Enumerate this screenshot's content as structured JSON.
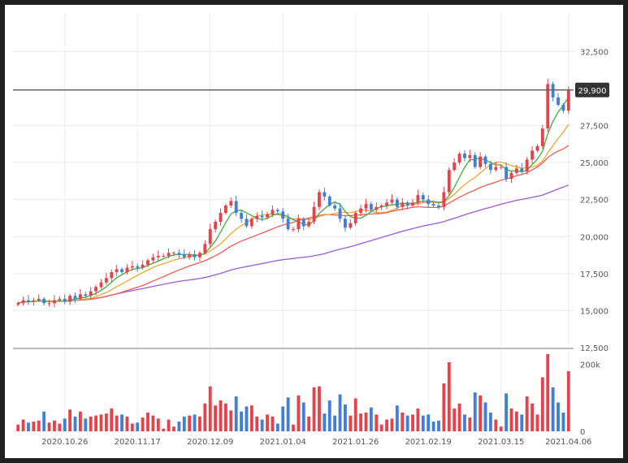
{
  "chart_data": {
    "type": "candlestick",
    "colors": {
      "up": "#e8414a",
      "down": "#3f7fd8",
      "ma_green": "#3caf3c",
      "ma_orange": "#f2a531",
      "ma_red": "#f15a5a",
      "ma_purple": "#9b5ad8",
      "grid": "#ececec",
      "current_price_line": "#666666",
      "current_price_label_bg": "#333333"
    },
    "y_ticks": [
      "32,500",
      "30,000",
      "27,500",
      "25,000",
      "22,500",
      "20,000",
      "17,500",
      "15,000",
      "12,500"
    ],
    "volume_ticks": [
      "200k",
      "0"
    ],
    "x_labels": [
      "2020.10.26",
      "2020.11.17",
      "2020.12.09",
      "2021.01.04",
      "2021.01.26",
      "2021.02.19",
      "2021.03.15",
      "2021.04.06"
    ],
    "current_price_label": "29,900",
    "current_price": 29900,
    "ylim": [
      12500,
      34000
    ],
    "volume_ylim": [
      0,
      230000
    ],
    "close": [
      15500,
      15700,
      15600,
      15700,
      15800,
      15500,
      15500,
      15700,
      15800,
      15600,
      16000,
      15800,
      16100,
      16000,
      16300,
      16600,
      16900,
      17200,
      17600,
      17800,
      17600,
      17900,
      18000,
      17900,
      18100,
      18400,
      18600,
      18700,
      18700,
      18900,
      18900,
      18800,
      18600,
      18800,
      18600,
      18900,
      19500,
      20500,
      21000,
      21600,
      22100,
      22400,
      21600,
      21200,
      20700,
      21200,
      21400,
      21300,
      21500,
      21800,
      21700,
      21200,
      20500,
      20500,
      21200,
      20700,
      21000,
      22000,
      23000,
      22700,
      22100,
      21900,
      21200,
      20600,
      20900,
      21600,
      21900,
      22200,
      21800,
      22000,
      22100,
      22300,
      22500,
      22000,
      22300,
      22100,
      22300,
      22800,
      22500,
      22200,
      22100,
      22000,
      23000,
      24500,
      25000,
      25600,
      25300,
      25500,
      24700,
      25400,
      24900,
      24500,
      24700,
      24700,
      23900,
      24300,
      24600,
      24400,
      25200,
      25800,
      26100,
      27300,
      30300,
      29400,
      28900,
      28500,
      29900
    ]
  }
}
